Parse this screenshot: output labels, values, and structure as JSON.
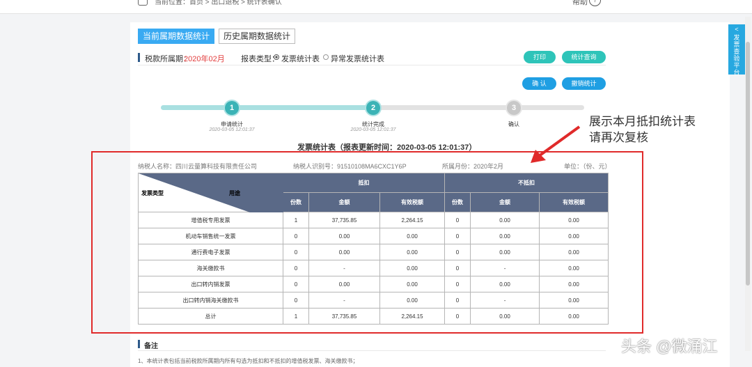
{
  "topbar": {
    "breadcrumb": "当前位置：首页 > 出口退税 > 统计表确认",
    "help_label": "帮助",
    "help_icon": "?"
  },
  "side_tab": {
    "arrow": "<",
    "label": "发票查验平台"
  },
  "tabs": [
    {
      "label": "当前属期数据统计"
    },
    {
      "label": "历史属期数据统计"
    }
  ],
  "filter": {
    "period_label": "税款所属期：",
    "period_value": "2020年02月",
    "report_type_label": "报表类型：",
    "options": [
      {
        "label": "发票统计表",
        "selected": true
      },
      {
        "label": "异常发票统计表",
        "selected": false
      }
    ]
  },
  "buttons": {
    "print": "打印",
    "stats_query": "统计查询",
    "confirm": "确 认",
    "cancel_stats": "撤销统计"
  },
  "steps": [
    {
      "num": "1",
      "label": "申请统计",
      "time": "2020-03-05 12:01:37",
      "done": true
    },
    {
      "num": "2",
      "label": "统计完成",
      "time": "2020-03-05 12:01:37",
      "done": true
    },
    {
      "num": "3",
      "label": "确认",
      "time": "",
      "done": false
    }
  ],
  "report": {
    "title": "发票统计表（报表更新时间：2020-03-05 12:01:37）",
    "taxpayer_name": "纳税人名称：四川云量算科技有限责任公司",
    "taxpayer_id": "纳税人识别号：91510108MA6CXC1Y6P",
    "period": "所属月份：2020年2月",
    "unit": "单位：（份、元）"
  },
  "table": {
    "corner_left": "发票类型",
    "corner_right": "用途",
    "group_headers": [
      "抵扣",
      "不抵扣"
    ],
    "sub_headers": [
      "份数",
      "金额",
      "有效税额",
      "份数",
      "金额",
      "有效税额"
    ],
    "rows": [
      {
        "type": "增值税专用发票",
        "cells": [
          "1",
          "37,735.85",
          "2,264.15",
          "0",
          "0.00",
          "0.00"
        ]
      },
      {
        "type": "机动车销售统一发票",
        "cells": [
          "0",
          "0.00",
          "0.00",
          "0",
          "0.00",
          "0.00"
        ]
      },
      {
        "type": "通行费电子发票",
        "cells": [
          "0",
          "0.00",
          "0.00",
          "0",
          "0.00",
          "0.00"
        ]
      },
      {
        "type": "海关缴款书",
        "cells": [
          "0",
          "-",
          "0.00",
          "0",
          "-",
          "0.00"
        ]
      },
      {
        "type": "出口转内销发票",
        "cells": [
          "0",
          "0.00",
          "0.00",
          "0",
          "0.00",
          "0.00"
        ]
      },
      {
        "type": "出口转内销海关缴款书",
        "cells": [
          "0",
          "-",
          "0.00",
          "0",
          "-",
          "0.00"
        ]
      },
      {
        "type": "总计",
        "cells": [
          "1",
          "37,735.85",
          "2,264.15",
          "0",
          "0.00",
          "0.00"
        ]
      }
    ]
  },
  "annotation": {
    "line1": "展示本月抵扣统计表",
    "line2": "请再次复核"
  },
  "remarks": {
    "title": "备注",
    "text": "1、本统计表包括当前税款所属期内所有勾选为抵扣和不抵扣的增值税发票、海关缴款书；"
  },
  "watermark": "头条 @微涌江",
  "colors": {
    "accent": "#39aaf2",
    "teal": "#2ec4b9",
    "header": "#5a6987",
    "highlight_red": "#e02a2a"
  }
}
